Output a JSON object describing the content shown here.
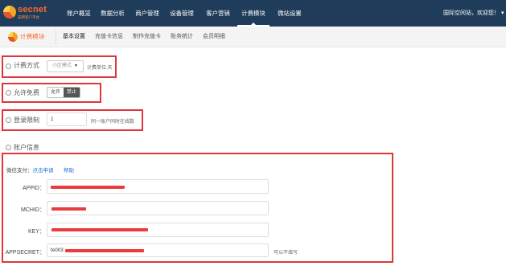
{
  "logo": {
    "name": "secnet",
    "subtitle": "安网客户平台"
  },
  "nav": {
    "items": [
      "账户概览",
      "数据分析",
      "商户管理",
      "设备管理",
      "客户营销",
      "计费模块",
      "微站设置"
    ],
    "active_index": 5,
    "user": "国际空间站，欢迎您！ ▾"
  },
  "module": {
    "title": "计费模块",
    "tabs": [
      "基本设置",
      "充值卡信息",
      "制作充值卡",
      "账务统计",
      "会员明细"
    ],
    "active_tab": 0
  },
  "billing": {
    "label": "计费方式",
    "select_value": "小区模式",
    "hint": "计费单位:天"
  },
  "free": {
    "label": "允许免费",
    "option_allow": "允许",
    "option_deny": "禁止",
    "selected": "禁止"
  },
  "login": {
    "label": "登录限制",
    "value": "1",
    "hint": "同一账户同时在线数"
  },
  "account": {
    "heading": "账户信息",
    "wechat_label": "微信支付：",
    "apply_link": "点击申请",
    "help_link": "帮助",
    "fields": [
      {
        "label": "APPID：",
        "value": ""
      },
      {
        "label": "MCHID：",
        "value": ""
      },
      {
        "label": "KEY：",
        "value": ""
      },
      {
        "label": "APPSECRET：",
        "value": "fe003",
        "hint": "可以不填写"
      }
    ]
  },
  "colors": {
    "nav_bg": "#1f3d5a",
    "accent": "#ff6a2a",
    "annotation": "#e0353b",
    "link": "#1e78d4"
  }
}
